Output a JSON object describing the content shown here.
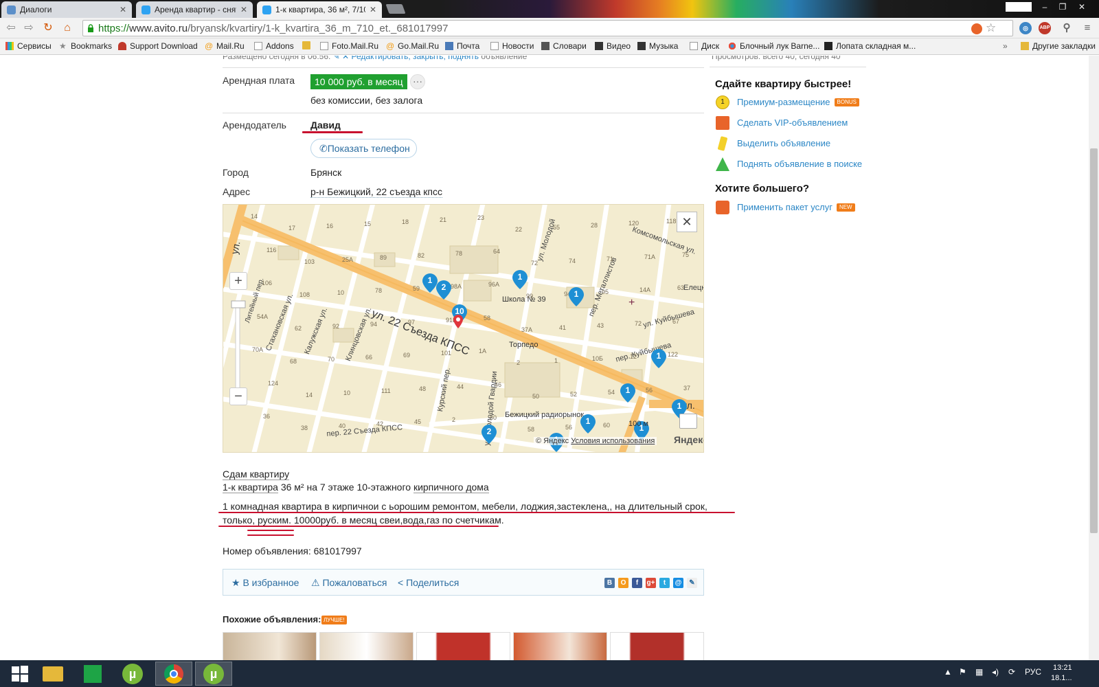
{
  "browser": {
    "tabs": [
      {
        "title": "Диалоги",
        "active": false
      },
      {
        "title": "Аренда квартир - снять к",
        "active": false
      },
      {
        "title": "1-к квартира, 36 м², 7/10",
        "active": true
      }
    ],
    "url_protocol": "https://",
    "url_host": "www.avito.ru",
    "url_path": "/bryansk/kvartiry/1-k_kvartira_36_m_710_et._681017997",
    "extension_badge": "ABP",
    "bookmarks": [
      {
        "label": "Сервисы",
        "icon": "apps-icon"
      },
      {
        "label": "Bookmarks",
        "icon": "star-icon"
      },
      {
        "label": "Support Download",
        "icon": "support-icon"
      },
      {
        "label": "Mail.Ru",
        "icon": "mailru-icon"
      },
      {
        "label": "Addons",
        "icon": "page-icon"
      },
      {
        "label": "",
        "icon": "folder-icon"
      },
      {
        "label": "Foto.Mail.Ru",
        "icon": "page-icon"
      },
      {
        "label": "Go.Mail.Ru",
        "icon": "mailru-icon"
      },
      {
        "label": "Почта",
        "icon": "mail-icon"
      },
      {
        "label": "Новости",
        "icon": "page-icon"
      },
      {
        "label": "Словари",
        "icon": "dictionary-icon"
      },
      {
        "label": "Видео",
        "icon": "video-icon"
      },
      {
        "label": "Музыка",
        "icon": "music-icon"
      },
      {
        "label": "Диск",
        "icon": "page-icon"
      },
      {
        "label": "Блочный лук Barne...",
        "icon": "dots-icon"
      },
      {
        "label": "Лопата складная м...",
        "icon": "shop-icon"
      }
    ],
    "other_bookmarks": "Другие закладки"
  },
  "listing": {
    "posted_prefix": "Размещено сегодня в 06:56.",
    "posted_links": "Редактировать, закрыть, поднять",
    "posted_suffix": "объявление",
    "views": "Просмотров: всего 40, сегодня 40",
    "rent_label": "Арендная плата",
    "price": "10 000 руб. в месяц",
    "more": "···",
    "price_note": "без комиссии, без залога",
    "landlord_label": "Арендодатель",
    "landlord_name": "Давид",
    "phone_button": "Показать телефон",
    "city_label": "Город",
    "city_value": "Брянск",
    "address_label": "Адрес",
    "address_value": "р-н Бежицкий, 22 съезда кпсс",
    "description_title": "Сдам квартиру",
    "description_type": "1-к квартира",
    "description_mid": " 36 м² на 7 этаже 10-этажного ",
    "description_material": "кирпичного дома",
    "description_line1": "1 комнадная квартира в кирпичнои с ьорошим ремонтом, мебели, лоджия,застеклена,, на длительный срок,",
    "description_line2": "только, руским. 10000руб. в месяц свеи,вода,газ по счетчикам.",
    "ad_number": "Номер объявления: 681017997",
    "actions": {
      "favorite": "В избранное",
      "report": "Пожаловаться",
      "share": "Поделиться"
    },
    "social": [
      "В",
      "О",
      "f",
      "g+",
      "t",
      "@",
      "✎"
    ],
    "similar_title": "Похожие объявления:",
    "similar_badge": "ЛУЧШЕ!"
  },
  "map": {
    "street_main": "ул. 22 Съезда КПСС",
    "copyright": "© Яндекс",
    "terms": "Условия использования",
    "brand": "Яндекс",
    "scale": "100 м",
    "labels": {
      "school": "Школа № 39",
      "torpedo": "Торпедо",
      "market": "Бежицкий радиорынок",
      "metallists": "пер. Металлистов",
      "kuibysheva": "ул. Куйбышева",
      "komsomol": "Комсомольская ул.",
      "kurskiy": "Курский пер.",
      "molodoy": "ул. Молодой Гвардии",
      "klintsovskaya": "Клинцовская ул.",
      "kaluzhskaya": "Калужская ул.",
      "stakhanovskaya": "Стахановская ул.",
      "liteyny": "Литейный пер.",
      "per22": "пер. 22 Съезда КПСС",
      "kuibysheva_per": "пер. Куйбышева",
      "eletskaya": "Елецк",
      "lenina": "ул.",
      "molodoy_top": "ул. Молодой",
      "left_street": "ул."
    },
    "buildings": [
      "14",
      "17",
      "16",
      "15",
      "18",
      "21",
      "23",
      "22",
      "55",
      "28",
      "120",
      "118",
      "116",
      "103",
      "25A",
      "89",
      "82",
      "78",
      "64",
      "72",
      "74",
      "71",
      "71A",
      "75",
      "106",
      "108",
      "10",
      "78",
      "59",
      "98A",
      "96A",
      "99",
      "94",
      "95",
      "14A",
      "63",
      "54A",
      "62",
      "92",
      "94",
      "97",
      "91Б",
      "58",
      "37A",
      "41",
      "43",
      "72",
      "67",
      "70A",
      "68",
      "70",
      "66",
      "69",
      "101",
      "1А",
      "2",
      "1",
      "10Б",
      "12",
      "122",
      "124",
      "14",
      "10",
      "111",
      "48",
      "44",
      "46",
      "50",
      "52",
      "54",
      "56",
      "37",
      "36",
      "38",
      "40",
      "42",
      "45",
      "2",
      "60",
      "58",
      "56",
      "60"
    ],
    "markers": [
      "1",
      "2",
      "10",
      "1",
      "1",
      "1",
      "1",
      "2",
      "1",
      "1",
      "1",
      "1"
    ]
  },
  "sidebar": {
    "promote_title": "Сдайте квартиру быстрее!",
    "promote_items": [
      {
        "label": "Премиум-размещение",
        "tag": "BONUS",
        "icon": "premium-icon"
      },
      {
        "label": "Сделать VIP-объявлением",
        "tag": "",
        "icon": "vip-icon"
      },
      {
        "label": "Выделить объявление",
        "tag": "",
        "icon": "highlighter-icon"
      },
      {
        "label": "Поднять объявление в поиске",
        "tag": "",
        "icon": "raise-icon"
      }
    ],
    "more_title": "Хотите большего?",
    "more_items": [
      {
        "label": "Применить пакет услуг",
        "tag": "NEW",
        "icon": "package-icon"
      }
    ]
  },
  "taskbar": {
    "apps": [
      "windows-start-icon",
      "file-explorer-icon",
      "store-icon",
      "utorrent-icon",
      "chrome-icon",
      "utorrent-icon"
    ],
    "lang": "РУС",
    "time": "13:21",
    "date": "18.1..."
  },
  "colors": {
    "price_green": "#20a030",
    "link_blue": "#2c87c6",
    "underline_red": "#c8102e",
    "accent_orange": "#f07d1a"
  }
}
